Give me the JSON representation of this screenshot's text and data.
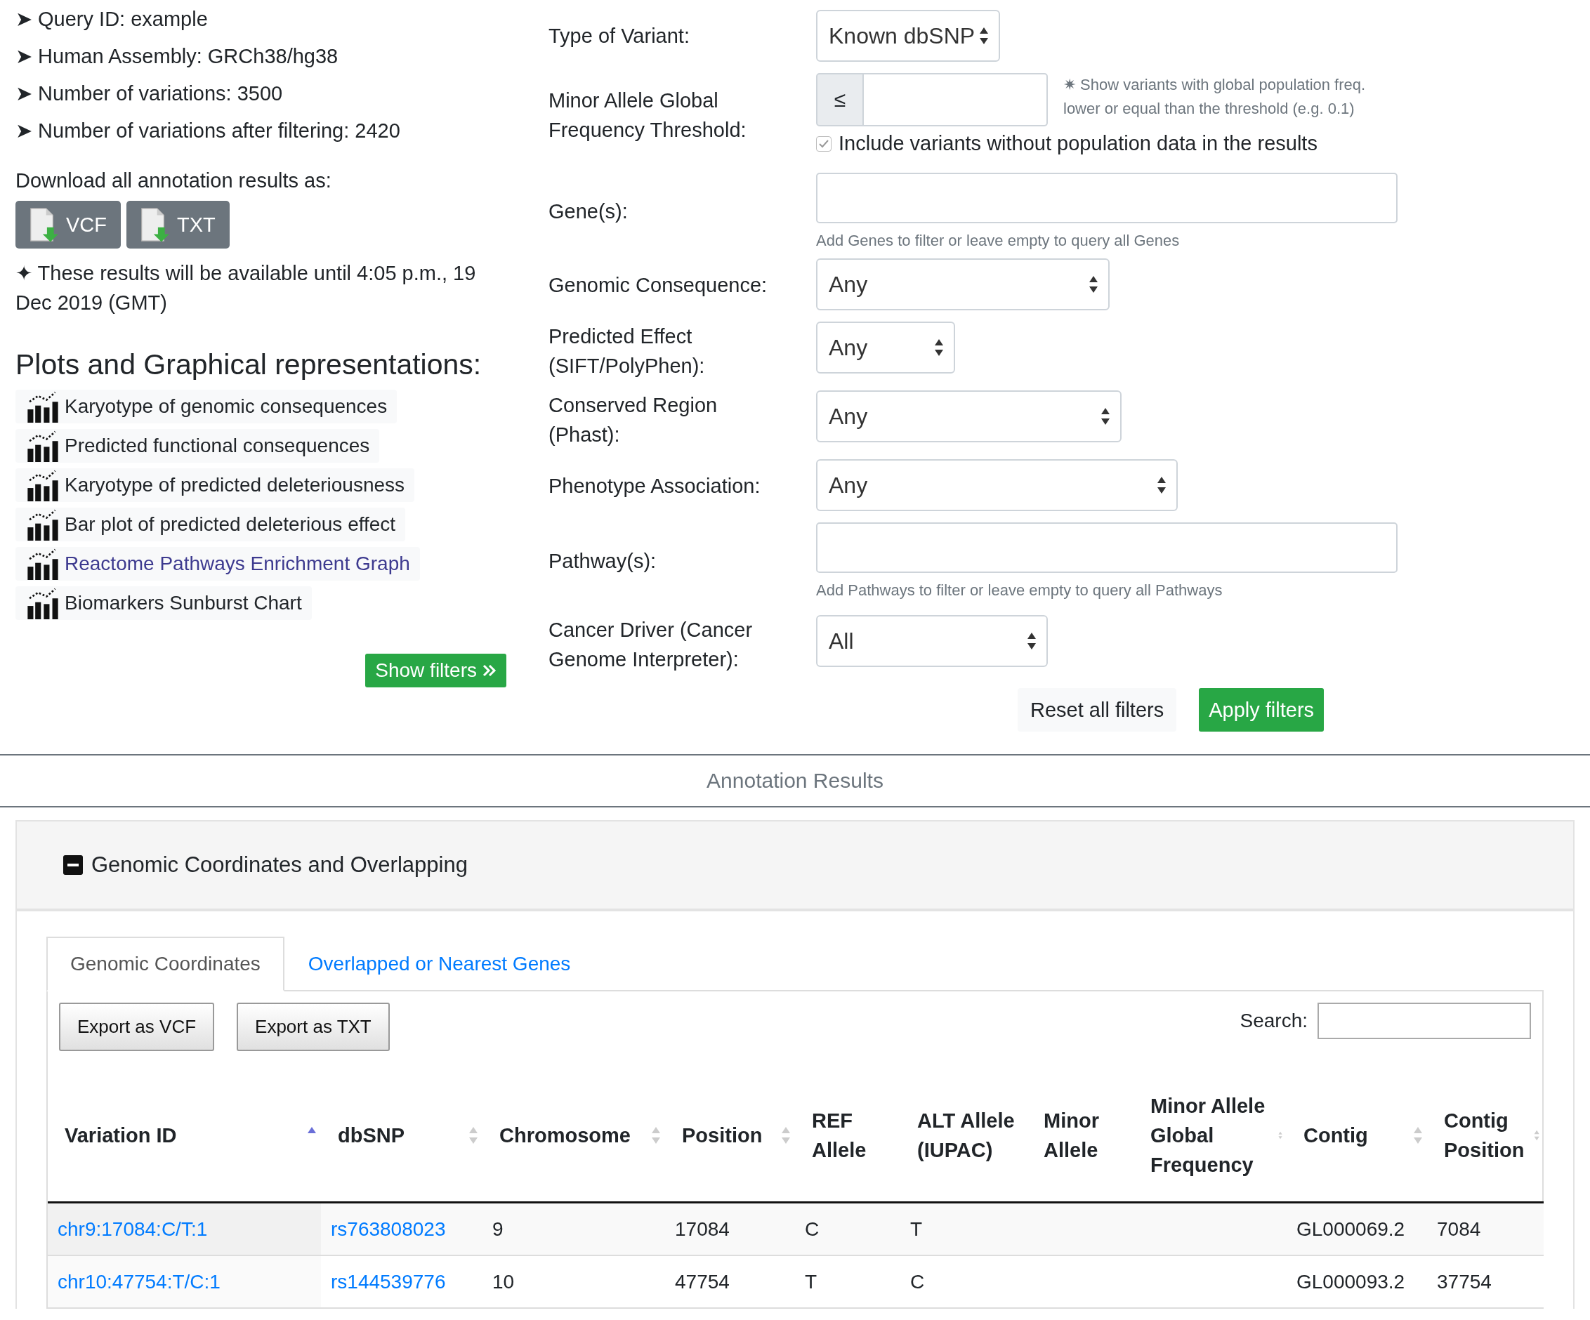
{
  "info": [
    "➤ Query ID: example",
    "➤ Human Assembly: GRCh38/hg38",
    "➤ Number of variations: 3500",
    "➤ Number of variations after filtering: 2420"
  ],
  "download": {
    "label": "Download all annotation results as:",
    "buttons": [
      "VCF",
      "TXT"
    ]
  },
  "availability": "✦ These results will be available until 4:05 p.m., 19 Dec 2019 (GMT)",
  "plots": {
    "title": "Plots and Graphical representations:",
    "items": [
      {
        "label": "Karyotype of genomic consequences",
        "visited": false
      },
      {
        "label": "Predicted functional consequences",
        "visited": false
      },
      {
        "label": "Karyotype of predicted deleteriousness",
        "visited": false
      },
      {
        "label": "Bar plot of predicted deleterious effect",
        "visited": false
      },
      {
        "label": "Reactome Pathways Enrichment Graph",
        "visited": true
      },
      {
        "label": "Biomarkers Sunburst Chart",
        "visited": false
      }
    ]
  },
  "show_filters": "Show filters",
  "filters": [
    {
      "kind": "select",
      "label": "Type of Variant:",
      "value": "Known dbSNP"
    },
    {
      "kind": "threshold",
      "label": "Minor Allele Global Frequency Threshold:",
      "prefix": "≤",
      "note": "✷ Show variants with global population freq. lower or equal than the threshold (e.g. 0.1)",
      "checkbox": {
        "label": "Include variants without population data in the results",
        "checked": true
      }
    },
    {
      "kind": "text",
      "label": "Gene(s):",
      "help": "Add Genes to filter or leave empty to query all Genes"
    },
    {
      "kind": "select",
      "label": "Genomic Consequence:",
      "value": "Any"
    },
    {
      "kind": "select",
      "label": "Predicted Effect (SIFT/PolyPhen):",
      "value": "Any"
    },
    {
      "kind": "select",
      "label": "Conserved Region (Phast):",
      "value": "Any"
    },
    {
      "kind": "select",
      "label": "Phenotype Association:",
      "value": "Any"
    },
    {
      "kind": "text",
      "label": "Pathway(s):",
      "help": "Add Pathways to filter or leave empty to query all Pathways"
    },
    {
      "kind": "select",
      "label": "Cancer Driver (Cancer Genome Interpreter):",
      "value": "All"
    }
  ],
  "filter_buttons": {
    "reset": "Reset all filters",
    "apply": "Apply filters"
  },
  "section_title": "Annotation Results",
  "panel": {
    "title": "Genomic Coordinates and Overlapping",
    "expanded": true,
    "tabs": [
      {
        "label": "Genomic Coordinates",
        "selected": true
      },
      {
        "label": "Overlapped or Nearest Genes",
        "selected": false
      }
    ],
    "export_buttons": [
      "Export as VCF",
      "Export as TXT"
    ],
    "search_label": "Search:",
    "table": {
      "columns": [
        {
          "label": "Variation ID",
          "sortable": true,
          "sorted": true
        },
        {
          "label": "dbSNP",
          "sortable": true,
          "sorted": false
        },
        {
          "label": "Chromosome",
          "sortable": true,
          "sorted": false
        },
        {
          "label": "Position",
          "sortable": true,
          "sorted": false
        },
        {
          "label": "REF Allele",
          "sortable": false
        },
        {
          "label": "ALT Allele (IUPAC)",
          "sortable": false
        },
        {
          "label": "Minor Allele",
          "sortable": false
        },
        {
          "label": "Minor Allele Global Frequency",
          "sortable": true,
          "sorted": false
        },
        {
          "label": "Contig",
          "sortable": true,
          "sorted": false
        },
        {
          "label": "Contig Position",
          "sortable": true,
          "sorted": false
        }
      ],
      "rows": [
        [
          "chr9:17084:C/T:1",
          "rs763808023",
          "9",
          "17084",
          "C",
          "T",
          "",
          "",
          "GL000069.2",
          "7084"
        ],
        [
          "chr10:47754:T/C:1",
          "rs144539776",
          "10",
          "47754",
          "T",
          "C",
          "",
          "",
          "GL000093.2",
          "37754"
        ]
      ]
    }
  }
}
